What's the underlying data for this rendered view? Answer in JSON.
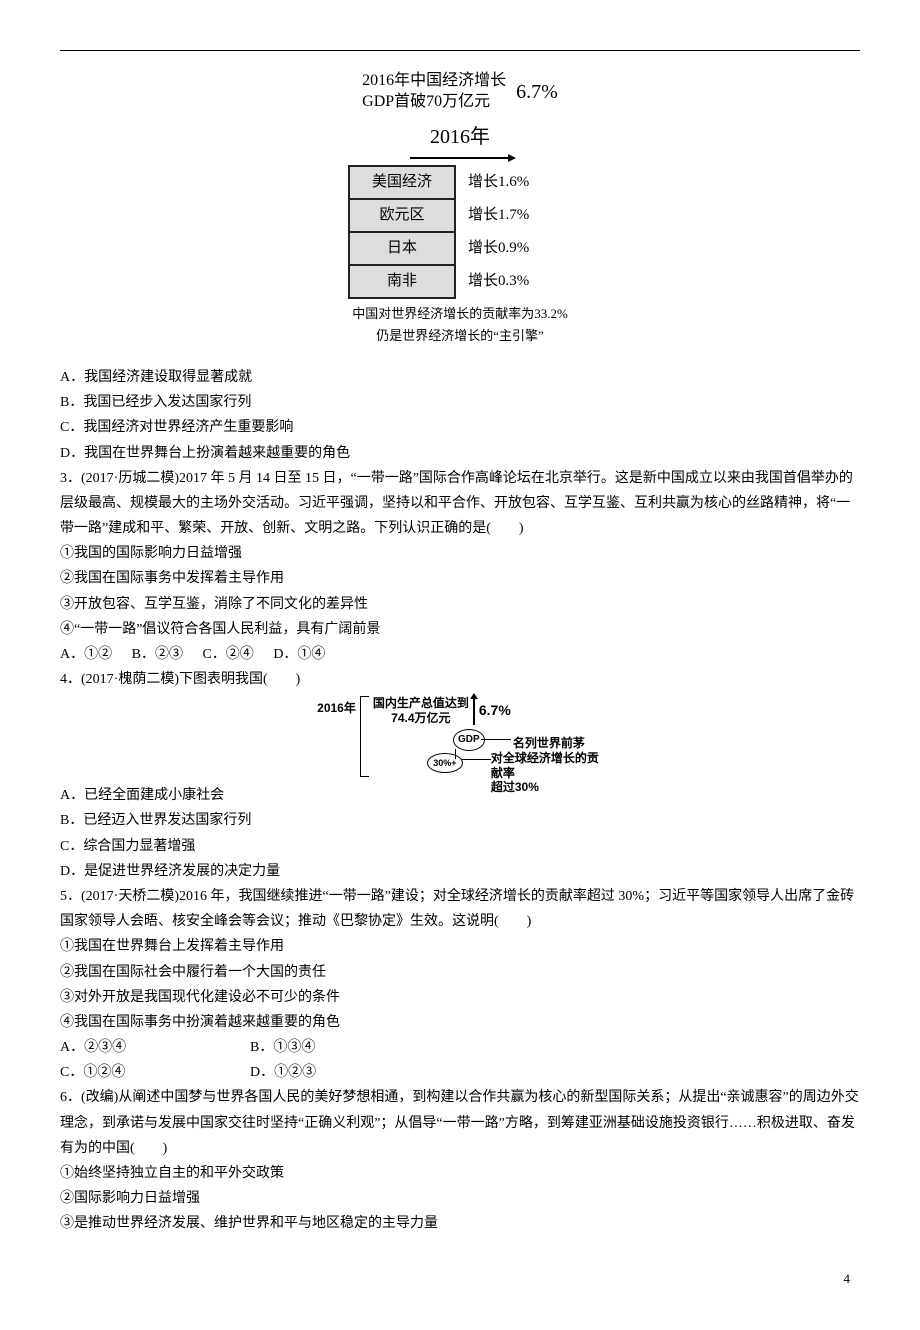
{
  "infobox1": {
    "title_line1": "2016年中国经济增长",
    "title_line2": "GDP首破70万亿元",
    "title_pct": "6.7%",
    "year_label": "2016年",
    "rows": [
      {
        "region": "美国经济",
        "growth": "增长1.6%"
      },
      {
        "region": "欧元区",
        "growth": "增长1.7%"
      },
      {
        "region": "日本",
        "growth": "增长0.9%"
      },
      {
        "region": "南非",
        "growth": "增长0.3%"
      }
    ],
    "caption_line1": "中国对世界经济增长的贡献率为33.2%",
    "caption_line2": "仍是世界经济增长的“主引擎”"
  },
  "q2": {
    "optA": "A．我国经济建设取得显著成就",
    "optB": "B．我国已经步入发达国家行列",
    "optC": "C．我国经济对世界经济产生重要影响",
    "optD": "D．我国在世界舞台上扮演着越来越重要的角色"
  },
  "q3": {
    "stem": "3．(2017·历城二模)2017 年 5 月 14 日至 15 日，“一带一路”国际合作高峰论坛在北京举行。这是新中国成立以来由我国首倡举办的层级最高、规模最大的主场外交活动。习近平强调，坚持以和平合作、开放包容、互学互鉴、互利共赢为核心的丝路精神，将“一带一路”建成和平、繁荣、开放、创新、文明之路。下列认识正确的是(　　)",
    "s1": "①我国的国际影响力日益增强",
    "s2": "②我国在国际事务中发挥着主导作用",
    "s3": "③开放包容、互学互鉴，消除了不同文化的差异性",
    "s4": "④“一带一路”倡议符合各国人民利益，具有广阔前景",
    "opts": {
      "A": "A．①②",
      "B": "B．②③",
      "C": "C．②④",
      "D": "D．①④"
    }
  },
  "q4": {
    "stem": "4．(2017·槐荫二模)下图表明我国(　　)",
    "fig": {
      "year": "2016年",
      "gdp_text_l1": "国内生产总值达到",
      "gdp_text_l2": "74.4万亿元",
      "pct": "6.7%",
      "gdp_small": "GDP",
      "pct30": "30%+",
      "right1": "名列世界前茅",
      "right2_l1": "对全球经济增长的贡献率",
      "right2_l2": "超过30%"
    },
    "optA": "A．已经全面建成小康社会",
    "optB": "B．已经迈入世界发达国家行列",
    "optC": "C．综合国力显著增强",
    "optD": "D．是促进世界经济发展的决定力量"
  },
  "q5": {
    "stem": "5．(2017·天桥二模)2016 年，我国继续推进“一带一路”建设；对全球经济增长的贡献率超过 30%；习近平等国家领导人出席了金砖国家领导人会晤、核安全峰会等会议；推动《巴黎协定》生效。这说明(　　)",
    "s1": "①我国在世界舞台上发挥着主导作用",
    "s2": "②我国在国际社会中履行着一个大国的责任",
    "s3": "③对外开放是我国现代化建设必不可少的条件",
    "s4": "④我国在国际事务中扮演着越来越重要的角色",
    "opts": {
      "A": "A．②③④",
      "B": "B．①③④",
      "C": "C．①②④",
      "D": "D．①②③"
    }
  },
  "q6": {
    "stem": "6．(改编)从阐述中国梦与世界各国人民的美好梦想相通，到构建以合作共赢为核心的新型国际关系；从提出“亲诚惠容”的周边外交理念，到承诺与发展中国家交往时坚持“正确义利观”；从倡导“一带一路”方略，到筹建亚洲基础设施投资银行……积极进取、奋发有为的中国(　　)",
    "s1": "①始终坚持独立自主的和平外交政策",
    "s2": "②国际影响力日益增强",
    "s3": "③是推动世界经济发展、维护世界和平与地区稳定的主导力量"
  },
  "page_number": "4"
}
